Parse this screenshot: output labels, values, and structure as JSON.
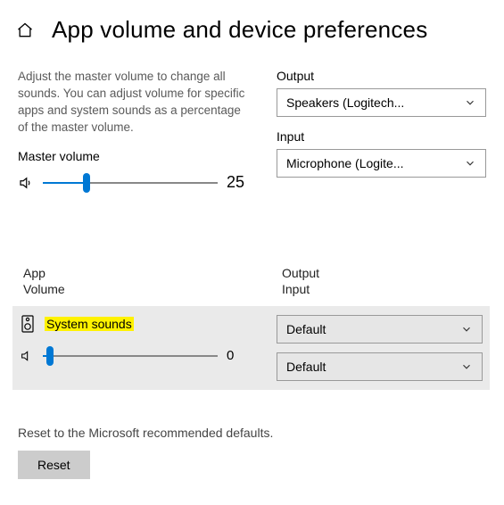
{
  "header": {
    "title": "App volume and device preferences"
  },
  "description": "Adjust the master volume to change all sounds. You can adjust volume for specific apps and system sounds as a percentage of the master volume.",
  "master": {
    "label": "Master volume",
    "value": 25
  },
  "output": {
    "label": "Output",
    "selected": "Speakers (Logitech..."
  },
  "input": {
    "label": "Input",
    "selected": "Microphone (Logite..."
  },
  "columns": {
    "appVolume": "App\nVolume",
    "outputInput": "Output\nInput"
  },
  "appRow": {
    "name": "System sounds",
    "volume": 0,
    "outputSelected": "Default",
    "inputSelected": "Default"
  },
  "reset": {
    "note": "Reset to the Microsoft recommended defaults.",
    "button": "Reset"
  }
}
